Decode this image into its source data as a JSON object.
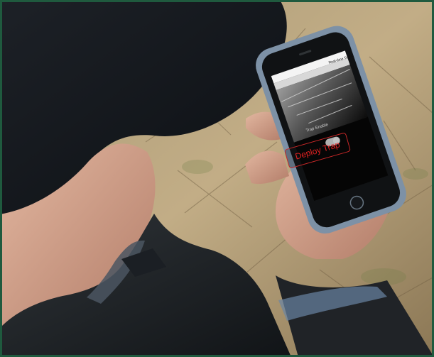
{
  "image": {
    "alt_visible_scene": ""
  },
  "phone": {
    "title": "Real-time Traps",
    "toggle_label": "Trap Enable",
    "button_label": "Deploy Trap"
  },
  "colors": {
    "border": "#1f5a3e",
    "button_red": "#e32121"
  }
}
